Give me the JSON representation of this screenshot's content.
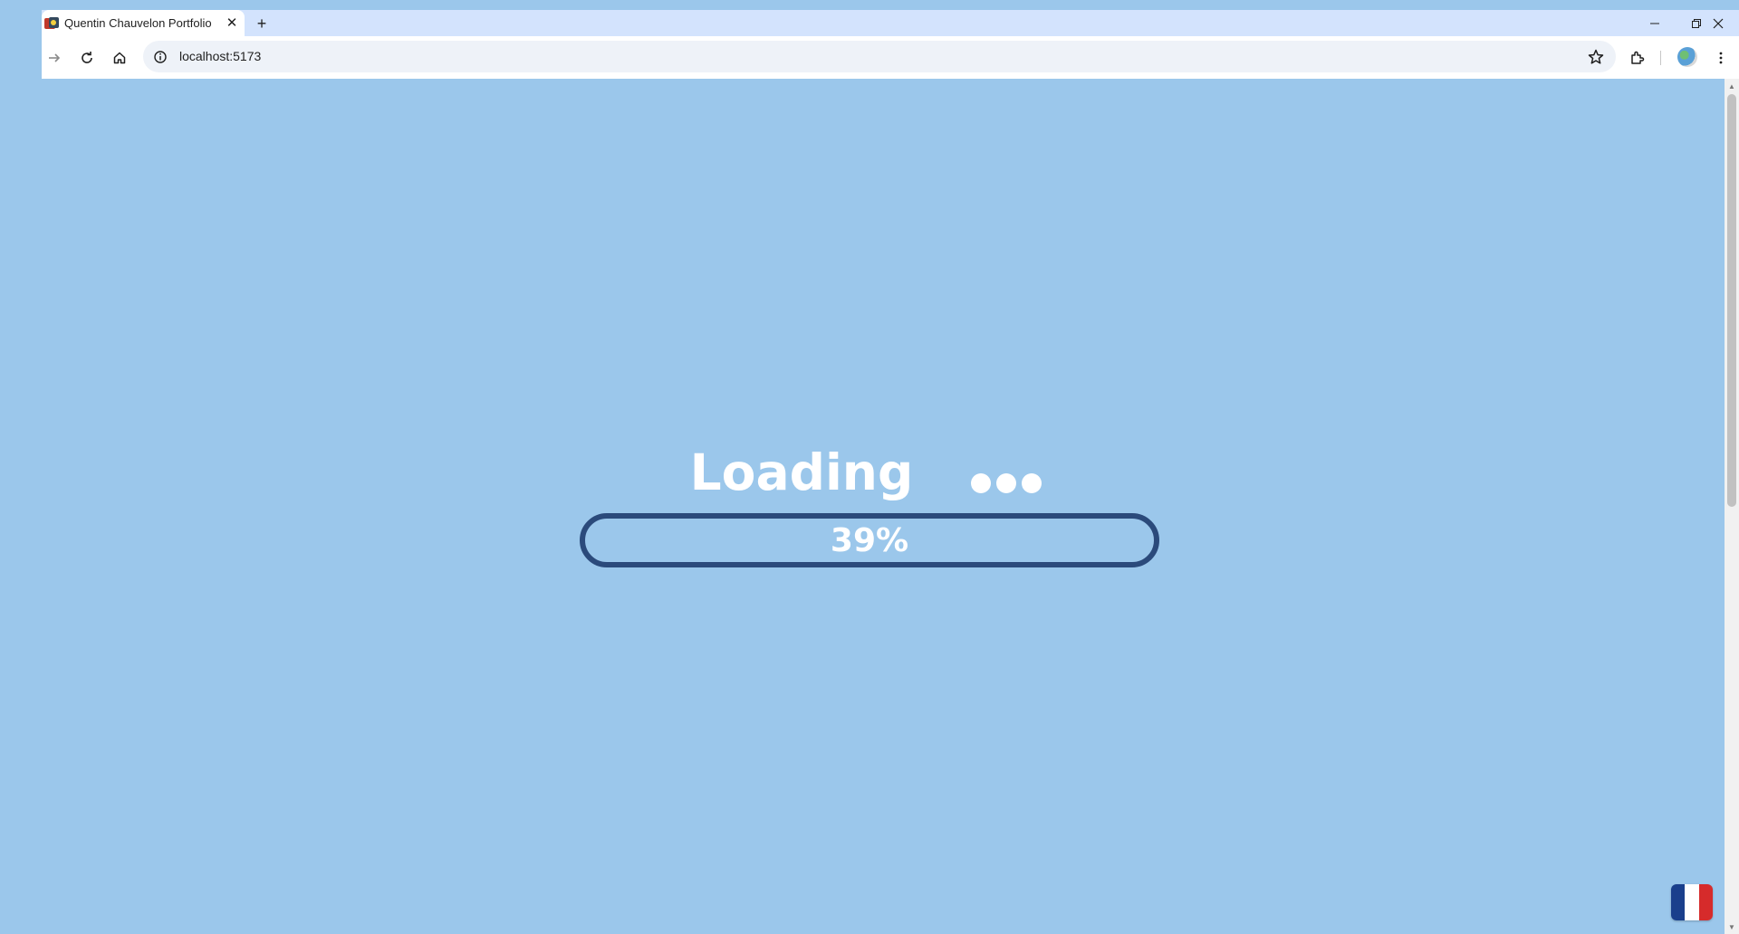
{
  "browser": {
    "tab": {
      "title": "Quentin Chauvelon Portfolio",
      "favicon": "portfolio-favicon",
      "close_glyph": "✕"
    },
    "new_tab_glyph": "+",
    "window_controls": {
      "minimize_glyph": "—",
      "restore_glyph": "❐",
      "close_glyph": "✕"
    },
    "toolbar": {
      "url": "localhost:5173",
      "icons": [
        "forward-icon",
        "reload-icon",
        "home-icon",
        "site-info-icon",
        "bookmark-star-icon",
        "extensions-icon",
        "profile-avatar",
        "menu-icon"
      ]
    }
  },
  "page": {
    "loading_text": "Loading",
    "progress": {
      "percent": 39,
      "label": "39%"
    },
    "language_flag": "french-flag",
    "colors": {
      "background": "#9bc7eb",
      "progress_border": "#2b4a7b",
      "text": "#ffffff",
      "flag_blue": "#1a3f8c",
      "flag_white": "#ffffff",
      "flag_red": "#d62b2b"
    }
  }
}
